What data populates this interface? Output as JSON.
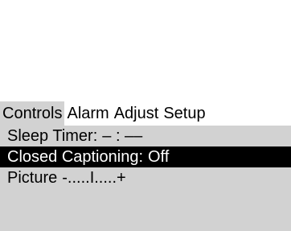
{
  "tabs": {
    "controls": "Controls",
    "alarm": "Alarm",
    "adjust": "Adjust",
    "setup": "Setup",
    "selected": "controls"
  },
  "menu": {
    "sleep_timer": {
      "label": "Sleep Timer:",
      "value": "– : ––"
    },
    "closed_captioning": {
      "label": "Closed Captioning:",
      "value": "Off",
      "highlighted": true
    },
    "picture": {
      "label": "Picture",
      "value": "-.....I.....+"
    }
  },
  "colors": {
    "panel_background": "#d2d2d2",
    "highlight_background": "#000000",
    "highlight_text": "#ffffff",
    "text": "#000000",
    "screen_background": "#ffffff"
  }
}
